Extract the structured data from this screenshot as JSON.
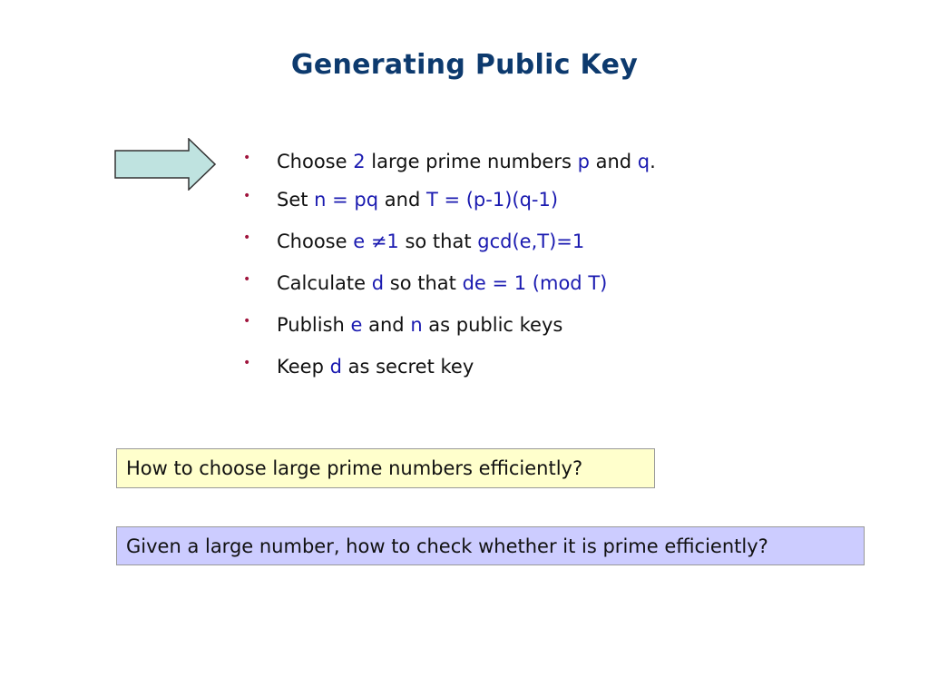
{
  "slide": {
    "title": "Generating Public Key",
    "bullet_glyph": "•",
    "bullets": [
      {
        "parts": [
          {
            "text": "Choose ",
            "hl": false
          },
          {
            "text": "2",
            "hl": true
          },
          {
            "text": " large prime numbers ",
            "hl": false
          },
          {
            "text": "p",
            "hl": true
          },
          {
            "text": " and ",
            "hl": false
          },
          {
            "text": "q",
            "hl": true
          },
          {
            "text": ".",
            "hl": false
          }
        ]
      },
      {
        "parts": [
          {
            "text": "Set ",
            "hl": false
          },
          {
            "text": "n = pq",
            "hl": true
          },
          {
            "text": " and ",
            "hl": false
          },
          {
            "text": "T = (p-1)(q-1)",
            "hl": true
          }
        ]
      },
      {
        "parts": [
          {
            "text": "Choose ",
            "hl": false
          },
          {
            "text": "e ≠1",
            "hl": true
          },
          {
            "text": " so that ",
            "hl": false
          },
          {
            "text": "gcd(e,T)=1",
            "hl": true
          }
        ]
      },
      {
        "parts": [
          {
            "text": "Calculate ",
            "hl": false
          },
          {
            "text": "d",
            "hl": true
          },
          {
            "text": " so that ",
            "hl": false
          },
          {
            "text": "de = 1 (mod T)",
            "hl": true
          }
        ]
      },
      {
        "parts": [
          {
            "text": "Publish ",
            "hl": false
          },
          {
            "text": "e",
            "hl": true
          },
          {
            "text": " and ",
            "hl": false
          },
          {
            "text": "n",
            "hl": true
          },
          {
            "text": " as public keys",
            "hl": false
          }
        ]
      },
      {
        "parts": [
          {
            "text": "Keep ",
            "hl": false
          },
          {
            "text": "d",
            "hl": true
          },
          {
            "text": " as secret key",
            "hl": false
          }
        ]
      }
    ],
    "question_boxes": [
      {
        "text": "How to choose large prime numbers efficiently?",
        "color": "#ffffcc"
      },
      {
        "text": "Given a large number, how to check whether it is prime efficiently?",
        "color": "#ccccff"
      }
    ],
    "icons": {
      "pointer": "right-arrow-icon"
    },
    "colors": {
      "title": "#0d3a6e",
      "highlight": "#1a1ab0",
      "bullet": "#a0143c",
      "arrow_fill": "#bfe3e0"
    }
  }
}
